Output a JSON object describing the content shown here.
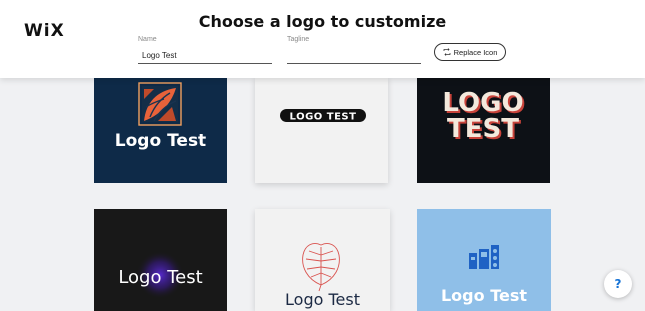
{
  "header": {
    "brand": "WiX",
    "title": "Choose a logo to customize",
    "name_field": {
      "label": "Name",
      "value": "Logo Test"
    },
    "tagline_field": {
      "label": "Tagline",
      "value": ""
    },
    "replace_icon_label": "Replace Icon"
  },
  "logos": [
    {
      "text": "Logo Test",
      "background": "#0e2a48"
    },
    {
      "text": "LOGO TEST",
      "background": "#f2f2f2"
    },
    {
      "line1": "LOGO",
      "line2": "TEST",
      "background": "#0d1116"
    },
    {
      "text": "Logo Test",
      "background": "#181818"
    },
    {
      "text": "Logo Test",
      "background": "#f2f2f2"
    },
    {
      "text": "Logo Test",
      "background": "#8fbfe8"
    }
  ],
  "help": {
    "label": "?"
  }
}
